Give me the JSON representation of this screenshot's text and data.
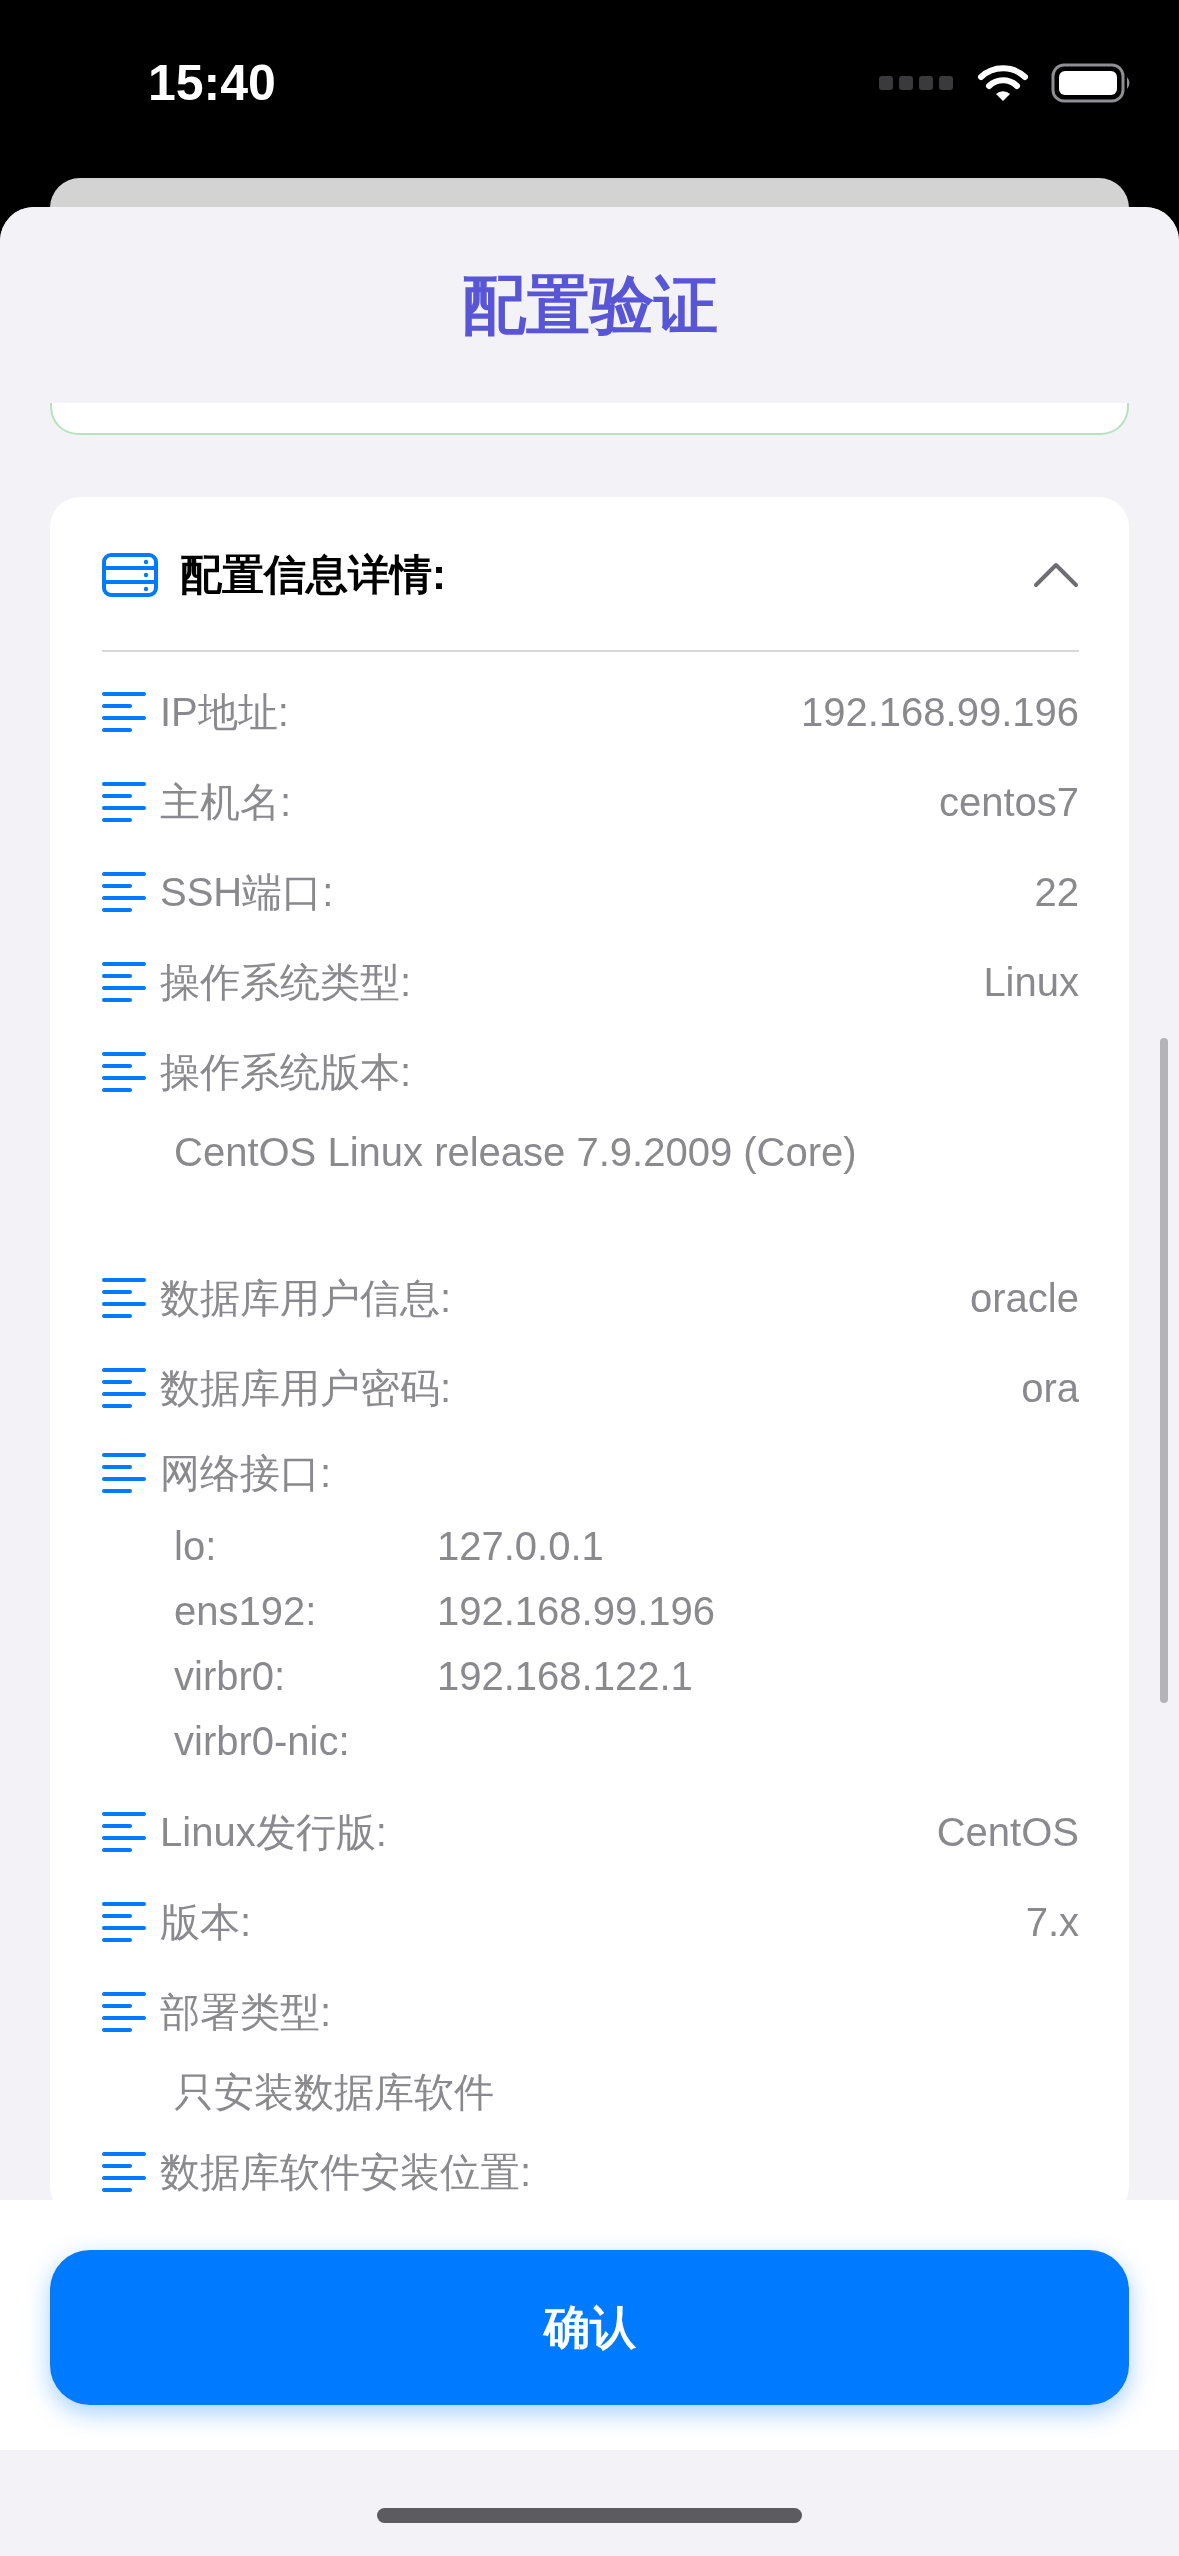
{
  "status_bar": {
    "time": "15:40"
  },
  "title": "配置验证",
  "details": {
    "title": "配置信息详情:",
    "expanded": true,
    "items": [
      {
        "kind": "inline",
        "label": "IP地址:",
        "value": "192.168.99.196"
      },
      {
        "kind": "inline",
        "label": "主机名:",
        "value": "centos7"
      },
      {
        "kind": "inline",
        "label": "SSH端口:",
        "value": "22"
      },
      {
        "kind": "inline",
        "label": "操作系统类型:",
        "value": "Linux"
      },
      {
        "kind": "block",
        "label": "操作系统版本:",
        "value": "CentOS Linux release 7.9.2009 (Core)",
        "blank_line_after": true
      },
      {
        "kind": "inline",
        "label": "数据库用户信息:",
        "value": "oracle"
      },
      {
        "kind": "inline",
        "label": "数据库用户密码:",
        "value": "ora"
      },
      {
        "kind": "list",
        "label": "网络接口:",
        "entries": [
          {
            "name": "lo:",
            "address": "127.0.0.1"
          },
          {
            "name": "ens192:",
            "address": "192.168.99.196"
          },
          {
            "name": "virbr0:",
            "address": "192.168.122.1"
          },
          {
            "name": "virbr0-nic:"
          }
        ]
      },
      {
        "kind": "inline",
        "label": "Linux发行版:",
        "value": "CentOS"
      },
      {
        "kind": "inline",
        "label": "版本:",
        "value": "7.x"
      },
      {
        "kind": "block",
        "label": "部署类型:",
        "value": "只安装数据库软件"
      },
      {
        "kind": "block",
        "label": "数据库软件安装位置:"
      }
    ]
  },
  "confirm_button": "确认"
}
